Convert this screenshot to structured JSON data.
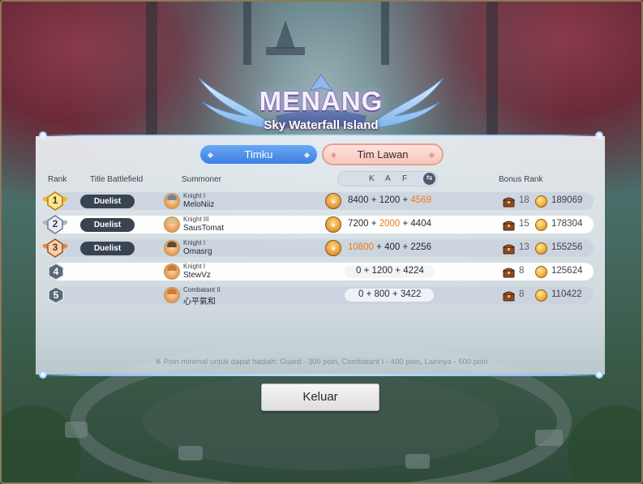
{
  "result": {
    "title": "MENANG",
    "map": "Sky Waterfall Island"
  },
  "tabs": {
    "mine": "Timku",
    "enemy": "Tim Lawan"
  },
  "headers": {
    "rank": "Rank",
    "title_battlefield": "Title Battlefield",
    "summoner": "Summoner",
    "k": "K",
    "a": "A",
    "f": "F",
    "bonus_rank": "Bonus Rank"
  },
  "players": [
    {
      "rank": "1",
      "title": "Duelist",
      "summoner_title": "Knight I",
      "name": "MeloNiiz",
      "k": "8400",
      "a": "1200",
      "f": "4569",
      "highlight": "f",
      "kaf_icon": "knight-badge",
      "bonus_rank": "18",
      "coins": "189069"
    },
    {
      "rank": "2",
      "title": "Duelist",
      "summoner_title": "Knight III",
      "name": "SausTomat",
      "k": "7200",
      "a": "2000",
      "f": "4404",
      "highlight": "a",
      "kaf_icon": "knight-badge",
      "bonus_rank": "15",
      "coins": "178304"
    },
    {
      "rank": "3",
      "title": "Duelist",
      "summoner_title": "Knight I",
      "name": "Omasrg",
      "k": "10800",
      "a": "400",
      "f": "2256",
      "highlight": "k",
      "kaf_icon": "combatant-badge",
      "bonus_rank": "13",
      "coins": "155256"
    },
    {
      "rank": "4",
      "title": "",
      "summoner_title": "Knight I",
      "name": "StewVz",
      "k": "0",
      "a": "1200",
      "f": "4224",
      "highlight": "",
      "kaf_icon": "",
      "bonus_rank": "8",
      "coins": "125624"
    },
    {
      "rank": "5",
      "title": "",
      "summoner_title": "Combatant II",
      "name": "心平氣和",
      "k": "0",
      "a": "800",
      "f": "3422",
      "highlight": "",
      "kaf_icon": "",
      "bonus_rank": "8",
      "coins": "110422"
    }
  ],
  "note": "※ Poin minimal untuk dapat hadiah: Guard - 300 poin, Combatant I - 400 poin, Lainnya - 500 poin",
  "button": {
    "exit": "Keluar"
  },
  "colors": {
    "highlight": "#f07a18",
    "tab_mine": "#3e7fe0",
    "tab_enemy": "#f7c6bc",
    "title_pill": "#394452"
  },
  "icons": {
    "swap": "swap-icon",
    "chest": "rank-chest-icon",
    "coin": "gold-coin-icon"
  }
}
